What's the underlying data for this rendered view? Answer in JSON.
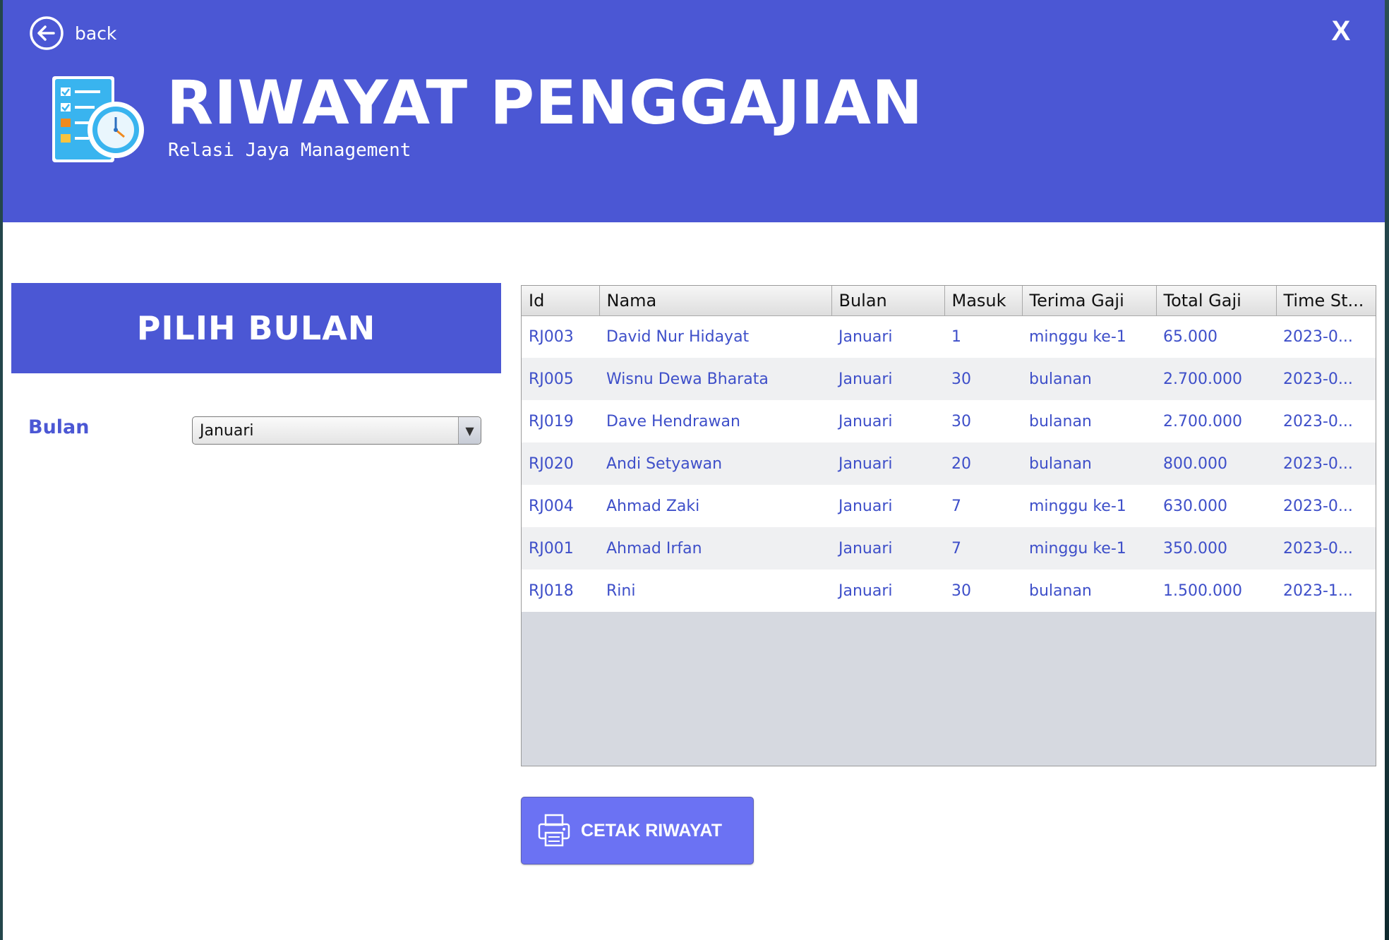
{
  "window": {
    "back_label": "back",
    "close_label": "X",
    "title": "RIWAYAT PENGGAJIAN",
    "subtitle": "Relasi Jaya Management"
  },
  "left_panel": {
    "banner": "PILIH BULAN",
    "bulan_label": "Bulan",
    "bulan_selected": "Januari"
  },
  "table": {
    "columns": [
      "Id",
      "Nama",
      "Bulan",
      "Masuk",
      "Terima Gaji",
      "Total Gaji",
      "Time St..."
    ],
    "rows": [
      [
        "RJ003",
        "David Nur Hidayat",
        "Januari",
        "1",
        "minggu ke-1",
        "65.000",
        "2023-0..."
      ],
      [
        "RJ005",
        "Wisnu Dewa Bharata",
        "Januari",
        "30",
        "bulanan",
        "2.700.000",
        "2023-0..."
      ],
      [
        "RJ019",
        "Dave Hendrawan",
        "Januari",
        "30",
        "bulanan",
        "2.700.000",
        "2023-0..."
      ],
      [
        "RJ020",
        "Andi Setyawan",
        "Januari",
        "20",
        "bulanan",
        "800.000",
        "2023-0..."
      ],
      [
        "RJ004",
        "Ahmad Zaki",
        "Januari",
        "7",
        "minggu ke-1",
        "630.000",
        "2023-0..."
      ],
      [
        "RJ001",
        "Ahmad Irfan",
        "Januari",
        "7",
        "minggu ke-1",
        "350.000",
        "2023-0..."
      ],
      [
        "RJ018",
        "Rini",
        "Januari",
        "30",
        "bulanan",
        "1.500.000",
        "2023-1..."
      ]
    ]
  },
  "print_button": {
    "label": "CETAK RIWAYAT",
    "icon": "printer-icon"
  },
  "colors": {
    "header": "#4b57d4",
    "cell_text": "#3e4fc9",
    "button": "#6b72f3"
  }
}
